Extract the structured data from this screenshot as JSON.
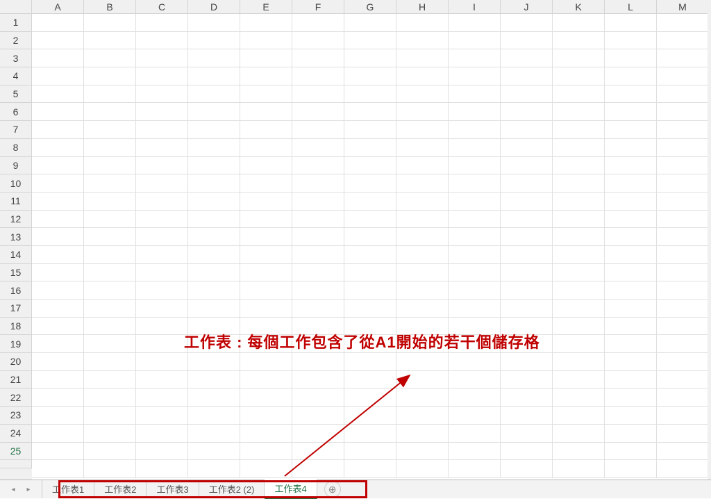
{
  "columns": [
    "A",
    "B",
    "C",
    "D",
    "E",
    "F",
    "G",
    "H",
    "I",
    "J",
    "K",
    "L",
    "M"
  ],
  "rows": [
    "1",
    "2",
    "3",
    "4",
    "5",
    "6",
    "7",
    "8",
    "9",
    "10",
    "11",
    "12",
    "13",
    "14",
    "15",
    "16",
    "17",
    "18",
    "19",
    "20",
    "21",
    "22",
    "23",
    "24",
    "25"
  ],
  "active_row": "25",
  "annotation": {
    "text": "工作表 : 每個工作包含了從A1開始的若干個儲存格"
  },
  "sheet_tabs": [
    {
      "label": "工作表1",
      "active": false
    },
    {
      "label": "工作表2",
      "active": false
    },
    {
      "label": "工作表3",
      "active": false
    },
    {
      "label": "工作表2 (2)",
      "active": false
    },
    {
      "label": "工作表4",
      "active": true
    }
  ],
  "nav": {
    "prev": "◂",
    "next": "▸"
  },
  "new_sheet": "⊕"
}
